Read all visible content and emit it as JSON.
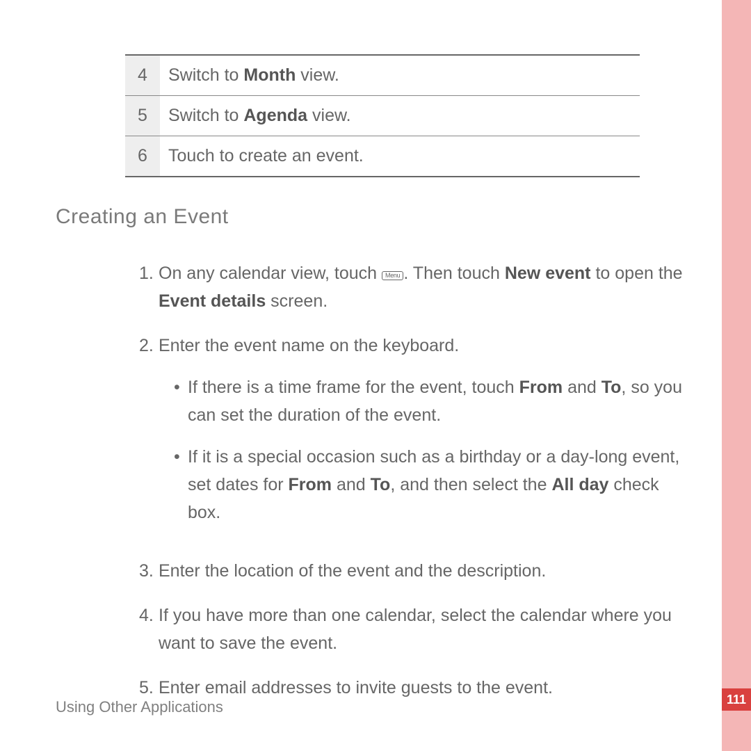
{
  "table": {
    "rows": [
      {
        "num": "4",
        "pre": "Switch to ",
        "bold": "Month",
        "post": " view."
      },
      {
        "num": "5",
        "pre": "Switch to ",
        "bold": "Agenda",
        "post": " view."
      },
      {
        "num": "6",
        "pre": "Touch to create an event.",
        "bold": "",
        "post": ""
      }
    ]
  },
  "heading": "Creating  an  Event",
  "steps": {
    "s1": {
      "num": "1.",
      "t1": "On any calendar view, touch ",
      "icon": "Menu",
      "t2": ". Then touch ",
      "b1": "New event",
      "t3": " to open the ",
      "b2": "Event details",
      "t4": " screen."
    },
    "s2": {
      "num": "2.",
      "text": "Enter the event name on the keyboard.",
      "bul1": {
        "t1": "If there is a time frame for the event, touch ",
        "b1": "From",
        "t2": " and ",
        "b2": "To",
        "t3": ", so you can set the duration of the event."
      },
      "bul2": {
        "t1": "If it is a special occasion such as a birthday or a day-long event, set dates for ",
        "b1": "From",
        "t2": " and ",
        "b2": "To",
        "t3": ", and then select the ",
        "b3": "All day",
        "t4": " check box."
      }
    },
    "s3": {
      "num": "3.",
      "text": "Enter the location of the event and the description."
    },
    "s4": {
      "num": "4.",
      "text": "If you have more than one calendar, select the calendar where you want to save the event."
    },
    "s5": {
      "num": "5.",
      "text": "Enter email addresses to invite guests to the event."
    }
  },
  "footer": "Using Other Applications",
  "pageNumber": "111",
  "bulletChar": "•"
}
